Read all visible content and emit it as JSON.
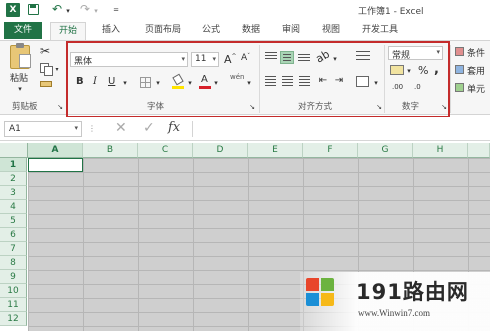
{
  "window": {
    "title": "工作簿1 - Excel",
    "controls": [
      "?",
      "—",
      "□"
    ]
  },
  "tabs": [
    {
      "label": "文件",
      "active": false,
      "file": true
    },
    {
      "label": "开始",
      "active": true
    },
    {
      "label": "插入"
    },
    {
      "label": "页面布局"
    },
    {
      "label": "公式"
    },
    {
      "label": "数据"
    },
    {
      "label": "审阅"
    },
    {
      "label": "视图"
    },
    {
      "label": "开发工具"
    }
  ],
  "clipboard": {
    "paste_label": "粘贴",
    "group_label": "剪贴板"
  },
  "font": {
    "name": "黑体",
    "size": "11",
    "grow_label": "A",
    "shrink_label": "A",
    "bold": "B",
    "italic": "I",
    "underline": "U",
    "font_color_letter": "A",
    "phonetic_label": "wén",
    "group_label": "字体"
  },
  "alignment": {
    "group_label": "对齐方式"
  },
  "number": {
    "format": "常规",
    "percent": "%",
    "comma": ",",
    "inc_decimal": ".00",
    "dec_decimal": ".0",
    "group_label": "数字"
  },
  "styles": {
    "items": [
      "条件",
      "套用",
      "单元"
    ]
  },
  "formula_bar": {
    "name_box": "A1",
    "fx": "fx",
    "cancel": "✕",
    "enter": "✓",
    "value": ""
  },
  "sheet": {
    "columns": [
      "A",
      "B",
      "C",
      "D",
      "E",
      "F",
      "G",
      "H"
    ],
    "rows": [
      "1",
      "2",
      "3",
      "4",
      "5",
      "6",
      "7",
      "8",
      "9",
      "10",
      "11",
      "12"
    ],
    "active_cell": "A1"
  },
  "watermark": {
    "brand": "191路由网",
    "url": "www.Winwin7.com"
  },
  "colors": {
    "excel_green": "#217346",
    "selection_red": "#c42b2b",
    "grid_gray": "#cfcfcf",
    "header_green_bg": "#e3efe7"
  }
}
